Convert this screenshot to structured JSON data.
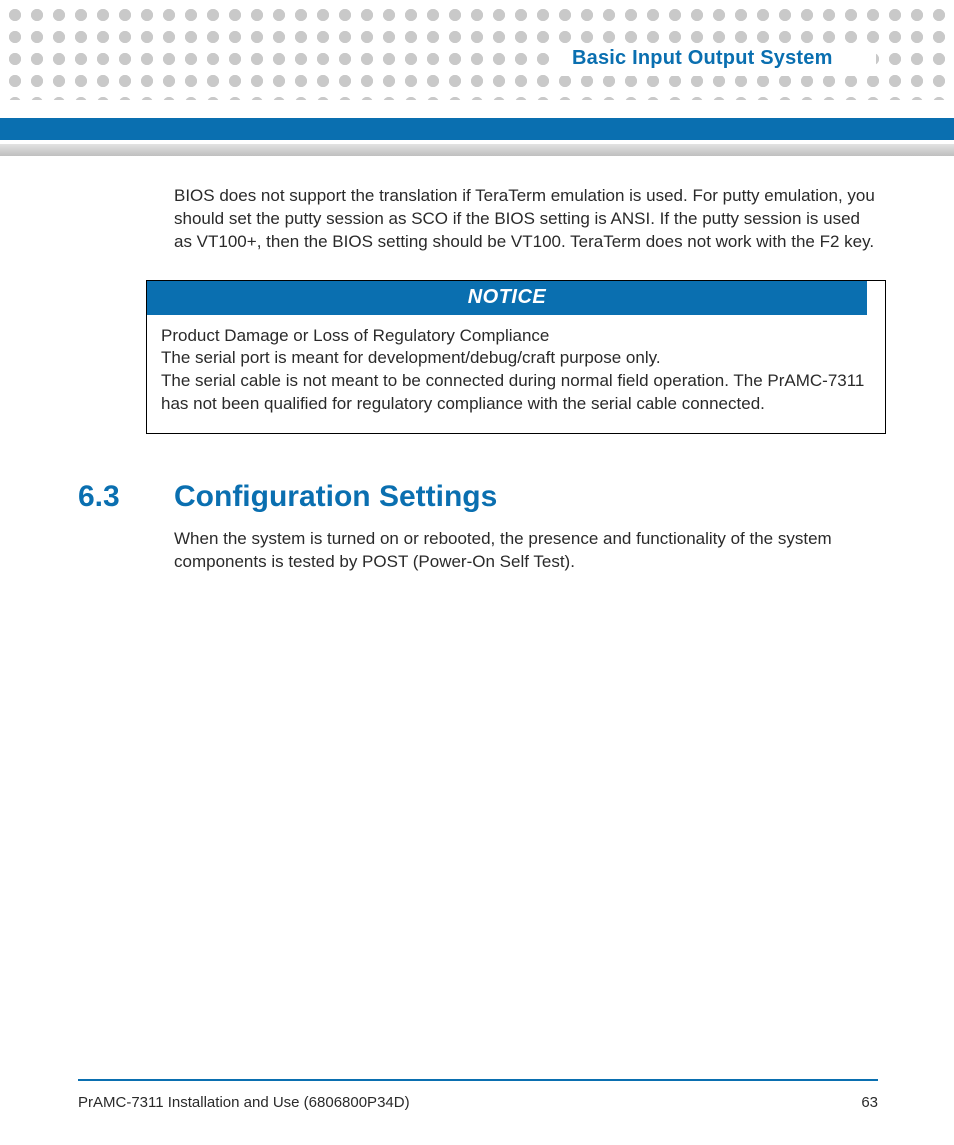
{
  "header": {
    "chapter_title": "Basic Input Output System"
  },
  "intro_paragraph": "BIOS does not support the translation if TeraTerm emulation is used. For putty emulation, you should set the putty session as SCO if the BIOS setting is ANSI. If the putty session is used as VT100+, then the BIOS setting should be VT100. TeraTerm does not work with the F2 key.",
  "notice": {
    "label": "NOTICE",
    "heading": "Product Damage or Loss of Regulatory Compliance",
    "line1": "The serial port is meant for development/debug/craft purpose only.",
    "line2": "The serial cable is not meant to be connected during normal field operation. The PrAMC-7311 has not been qualified for regulatory compliance with the serial cable connected."
  },
  "section": {
    "number": "6.3",
    "title": "Configuration Settings",
    "text": "When the system is turned on or rebooted, the presence and functionality of the system components is tested by POST (Power-On Self Test)."
  },
  "footer": {
    "doc_title": "PrAMC-7311 Installation and Use (6806800P34D)",
    "page_number": "63"
  }
}
